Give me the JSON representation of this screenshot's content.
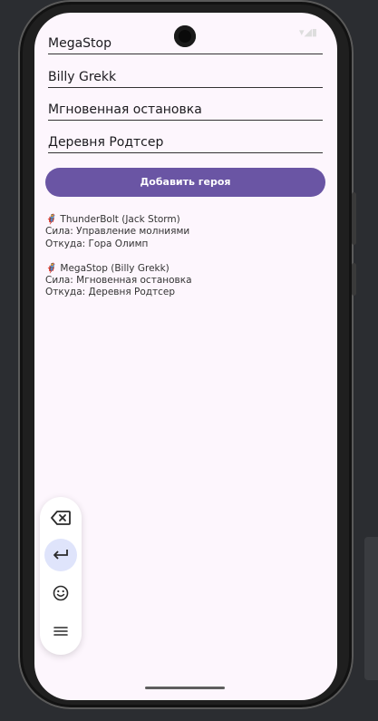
{
  "statusbar": {
    "icons": "▾◢▮"
  },
  "form": {
    "name_value": "MegaStop",
    "real_name_value": "Billy Grekk",
    "power_value": "Мгновенная остановка",
    "origin_value": "Деревня Родтсер",
    "add_button_label": "Добавить героя"
  },
  "heroes": [
    {
      "title": "🦸 ThunderBolt (Jack Storm)",
      "power": "Сила: Управление молниями",
      "origin": "Откуда: Гора Олимп"
    },
    {
      "title": "🦸 MegaStop (Billy Grekk)",
      "power": "Сила: Мгновенная остановка",
      "origin": "Откуда: Деревня Родтсер"
    }
  ],
  "keyboard": {
    "keys": [
      "backspace-icon",
      "enter-icon",
      "emoji-icon",
      "menu-icon"
    ],
    "active_key": "enter-icon"
  },
  "colors": {
    "accent": "#6a55a4",
    "screen_bg": "#fdf6fd",
    "active_key_bg": "#dfe4fb"
  }
}
